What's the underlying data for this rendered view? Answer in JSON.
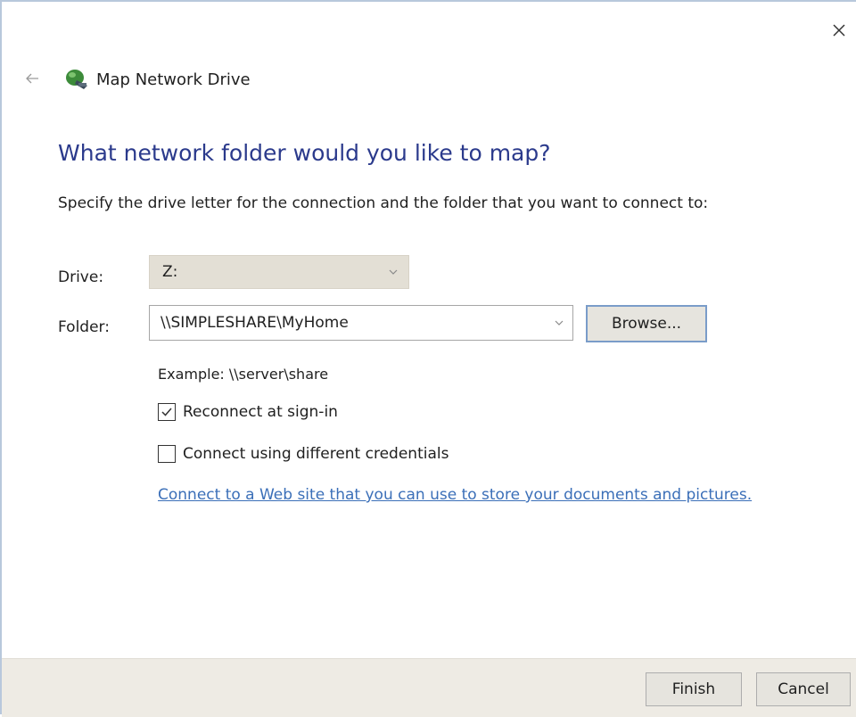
{
  "window": {
    "title": "Map Network Drive",
    "close_icon": "close-icon",
    "back_icon": "back-arrow-icon",
    "app_icon": "network-drive-icon"
  },
  "main": {
    "heading": "What network folder would you like to map?",
    "instructions": "Specify the drive letter for the connection and the folder that you want to connect to:"
  },
  "drive": {
    "label": "Drive:",
    "value": "Z:"
  },
  "folder": {
    "label": "Folder:",
    "value": "\\\\SIMPLESHARE\\MyHome",
    "browse_label": "Browse...",
    "example": "Example: \\\\server\\share"
  },
  "options": {
    "reconnect": {
      "label": "Reconnect at sign-in",
      "checked": true
    },
    "credentials": {
      "label": "Connect using different credentials",
      "checked": false
    }
  },
  "link": {
    "text": "Connect to a Web site that you can use to store your documents and pictures."
  },
  "footer": {
    "finish_label": "Finish",
    "cancel_label": "Cancel"
  },
  "colors": {
    "heading": "#2b3a8c",
    "link": "#3b6fb8",
    "footer_bg": "#eeebe4",
    "browse_border": "#7a9cc9"
  }
}
